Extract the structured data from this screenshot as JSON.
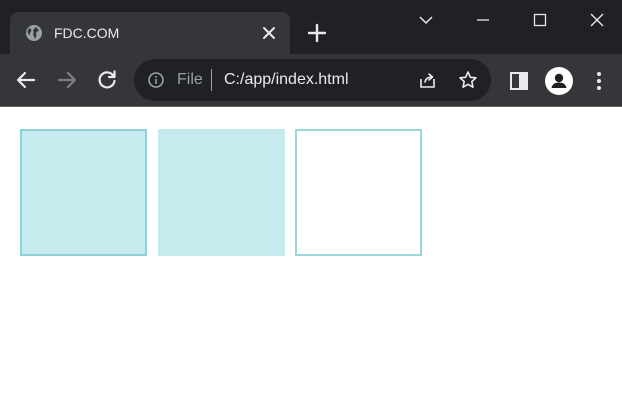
{
  "browser": {
    "tab": {
      "title": "FDC.COM",
      "icon": "globe-icon",
      "close_icon": "close-icon"
    },
    "new_tab_icon": "plus-icon",
    "window_controls": [
      "chevron-down-icon",
      "minimize-icon",
      "maximize-icon",
      "close-icon"
    ],
    "toolbar": {
      "back_icon": "back-arrow-icon",
      "forward_icon": "forward-arrow-icon",
      "reload_icon": "reload-icon",
      "address": {
        "info_icon": "info-icon",
        "scheme_label": "File",
        "url": "C:/app/index.html",
        "share_icon": "share-icon",
        "bookmark_icon": "star-icon"
      },
      "side_panel_icon": "side-panel-icon",
      "profile_icon": "person-icon",
      "menu_icon": "kebab-menu-icon"
    },
    "colors": {
      "titlebar": "#202124",
      "toolbar": "#35363a",
      "box_fill": "#c6ebee",
      "box_border": "#8fd0d9"
    }
  },
  "page": {
    "boxes": [
      {
        "name": "filled-bordered-box",
        "fill": "#c6ebee",
        "border": "#8fd0d9"
      },
      {
        "name": "filled-box",
        "fill": "#c6ebee",
        "border": "none"
      },
      {
        "name": "outlined-box",
        "fill": "#ffffff",
        "border": "#9ad6dc"
      }
    ]
  }
}
